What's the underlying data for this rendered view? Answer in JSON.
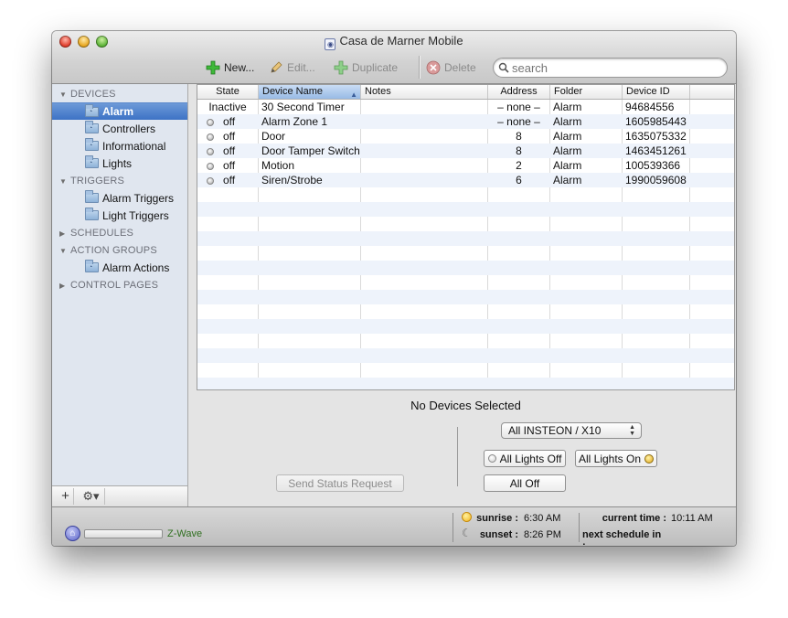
{
  "window": {
    "title": "Casa de Marner Mobile"
  },
  "toolbar": {
    "new_label": "New...",
    "edit_label": "Edit...",
    "duplicate_label": "Duplicate",
    "delete_label": "Delete",
    "search_placeholder": "search"
  },
  "sidebar": {
    "groups": [
      {
        "label": "DEVICES",
        "expanded": true,
        "items": [
          "Alarm",
          "Controllers",
          "Informational",
          "Lights"
        ],
        "selected": "Alarm"
      },
      {
        "label": "TRIGGERS",
        "expanded": true,
        "items": [
          "Alarm Triggers",
          "Light Triggers"
        ]
      },
      {
        "label": "SCHEDULES",
        "expanded": false,
        "items": []
      },
      {
        "label": "ACTION GROUPS",
        "expanded": true,
        "items": [
          "Alarm Actions"
        ]
      },
      {
        "label": "CONTROL PAGES",
        "expanded": false,
        "items": []
      }
    ]
  },
  "table": {
    "columns": [
      "State",
      "Device Name",
      "Notes",
      "Address",
      "Folder",
      "Device ID"
    ],
    "sorted_column": "Device Name",
    "rows": [
      {
        "state": "Inactive",
        "state_icon": false,
        "name": "30 Second Timer",
        "notes": "",
        "address": "– none –",
        "folder": "Alarm",
        "device_id": "94684556"
      },
      {
        "state": "off",
        "state_icon": true,
        "name": "Alarm Zone 1",
        "notes": "",
        "address": "– none –",
        "folder": "Alarm",
        "device_id": "1605985443"
      },
      {
        "state": "off",
        "state_icon": true,
        "name": "Door",
        "notes": "",
        "address": "8",
        "folder": "Alarm",
        "device_id": "1635075332"
      },
      {
        "state": "off",
        "state_icon": true,
        "name": "Door Tamper Switch",
        "notes": "",
        "address": "8",
        "folder": "Alarm",
        "device_id": "1463451261"
      },
      {
        "state": "off",
        "state_icon": true,
        "name": "Motion",
        "notes": "",
        "address": "2",
        "folder": "Alarm",
        "device_id": "100539366"
      },
      {
        "state": "off",
        "state_icon": true,
        "name": "Siren/Strobe",
        "notes": "",
        "address": "6",
        "folder": "Alarm",
        "device_id": "1990059608"
      }
    ]
  },
  "detail": {
    "title": "No Devices Selected",
    "send_status_label": "Send Status Request",
    "protocol_select": "All INSTEON / X10",
    "all_lights_off_label": "All Lights Off",
    "all_lights_on_label": "All Lights On",
    "all_off_label": "All Off"
  },
  "statusbar": {
    "interface_label": "Z-Wave",
    "sunrise_label": "sunrise :",
    "sunrise_value": "6:30 AM",
    "sunset_label": "sunset :",
    "sunset_value": "8:26 PM",
    "current_time_label": "current time :",
    "current_time_value": "10:11 AM",
    "next_schedule_label": "next schedule in :",
    "next_schedule_value": ""
  }
}
